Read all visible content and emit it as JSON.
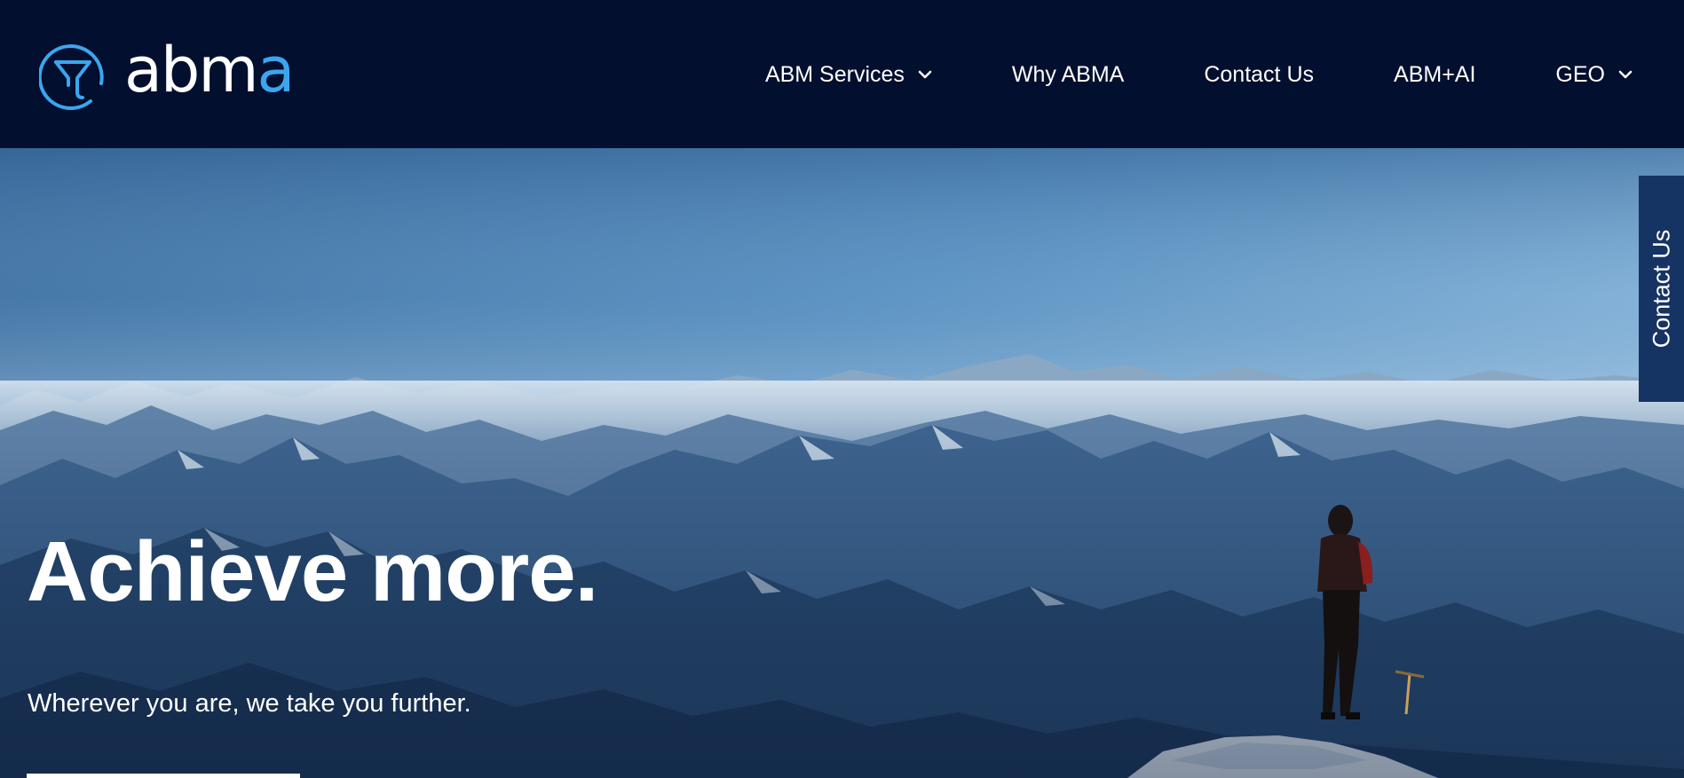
{
  "brand": {
    "wordmark_main": "abm",
    "wordmark_accent": "a",
    "logo_icon": "funnel-circle-icon",
    "accent_color": "#3ba6f0",
    "header_color": "#020f2e"
  },
  "nav": {
    "items": [
      {
        "label": "ABM Services",
        "has_dropdown": true
      },
      {
        "label": "Why ABMA",
        "has_dropdown": false
      },
      {
        "label": "Contact Us",
        "has_dropdown": false
      },
      {
        "label": "ABM+AI",
        "has_dropdown": false
      },
      {
        "label": "GEO",
        "has_dropdown": true
      }
    ]
  },
  "hero": {
    "headline": "Achieve more.",
    "subtext": "Wherever you are, we take you further.",
    "background": "mountain-summit-climber-photo"
  },
  "side_tab": {
    "label": "Contact Us",
    "color": "#163463"
  }
}
